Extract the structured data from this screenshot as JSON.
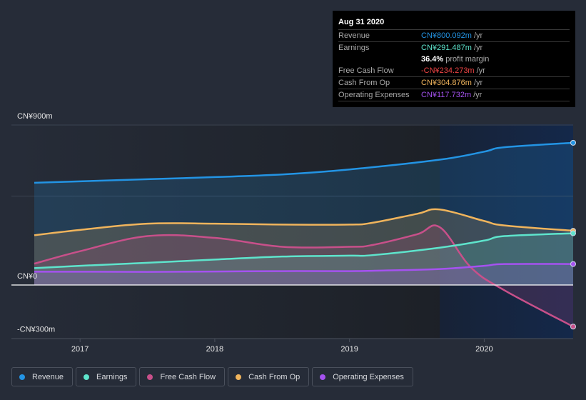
{
  "tooltip": {
    "date": "Aug 31 2020",
    "rows": [
      {
        "label": "Revenue",
        "value": "CN¥800.092m",
        "unit": "/yr",
        "color": "#2394e4"
      },
      {
        "label": "Earnings",
        "value": "CN¥291.487m",
        "unit": "/yr",
        "color": "#5ee4cc"
      },
      {
        "label": "",
        "value": "36.4%",
        "unit": "profit margin",
        "color": "#ffffff"
      },
      {
        "label": "Free Cash Flow",
        "value": "-CN¥234.273m",
        "unit": "/yr",
        "color": "#ee4444"
      },
      {
        "label": "Cash From Op",
        "value": "CN¥304.876m",
        "unit": "/yr",
        "color": "#f0b45c"
      },
      {
        "label": "Operating Expenses",
        "value": "CN¥117.732m",
        "unit": "/yr",
        "color": "#a552f0"
      }
    ]
  },
  "legend": [
    {
      "label": "Revenue",
      "color": "#2394e4"
    },
    {
      "label": "Earnings",
      "color": "#5ee4cc"
    },
    {
      "label": "Free Cash Flow",
      "color": "#c8508a"
    },
    {
      "label": "Cash From Op",
      "color": "#f0b45c"
    },
    {
      "label": "Operating Expenses",
      "color": "#a552f0"
    }
  ],
  "chart_data": {
    "type": "area",
    "title": "",
    "xlabel": "",
    "ylabel": "",
    "ylim": [
      -300,
      900
    ],
    "xlim": [
      2016.66,
      2020.66
    ],
    "y_tick_labels": [
      {
        "value": 900,
        "label": "CN¥900m"
      },
      {
        "value": 0,
        "label": "CN¥0"
      },
      {
        "value": -300,
        "label": "-CN¥300m"
      }
    ],
    "gridlines": [
      900,
      500,
      0
    ],
    "x_ticks": [
      {
        "value": 2017,
        "label": "2017"
      },
      {
        "value": 2018,
        "label": "2018"
      },
      {
        "value": 2019,
        "label": "2019"
      },
      {
        "value": 2020,
        "label": "2020"
      }
    ],
    "forecast_shade_start": 2019.67,
    "series": [
      {
        "name": "Revenue",
        "color": "#2394e4",
        "x": [
          2016.66,
          2017.0,
          2017.5,
          2018.0,
          2018.5,
          2019.0,
          2019.67,
          2020.0,
          2020.15,
          2020.66
        ],
        "values": [
          575,
          583,
          595,
          607,
          622,
          650,
          705,
          750,
          775,
          800
        ]
      },
      {
        "name": "Cash From Op",
        "color": "#f0b45c",
        "x": [
          2016.66,
          2017.0,
          2017.5,
          2018.0,
          2018.5,
          2019.0,
          2019.17,
          2019.5,
          2019.67,
          2020.0,
          2020.15,
          2020.66
        ],
        "values": [
          280,
          310,
          345,
          345,
          340,
          340,
          350,
          400,
          425,
          360,
          335,
          305
        ]
      },
      {
        "name": "Free Cash Flow",
        "color": "#c8508a",
        "x": [
          2016.66,
          2017.0,
          2017.5,
          2018.0,
          2018.5,
          2019.0,
          2019.17,
          2019.5,
          2019.67,
          2019.9,
          2020.15,
          2020.66
        ],
        "values": [
          120,
          190,
          275,
          265,
          215,
          215,
          225,
          285,
          325,
          100,
          -30,
          -234
        ]
      },
      {
        "name": "Earnings",
        "color": "#5ee4cc",
        "x": [
          2016.66,
          2017.0,
          2017.5,
          2018.0,
          2018.5,
          2019.0,
          2019.17,
          2019.67,
          2020.0,
          2020.15,
          2020.66
        ],
        "values": [
          95,
          108,
          125,
          143,
          160,
          165,
          168,
          210,
          250,
          275,
          291
        ]
      },
      {
        "name": "Operating Expenses",
        "color": "#a552f0",
        "x": [
          2016.66,
          2017.0,
          2017.5,
          2018.0,
          2018.5,
          2019.0,
          2019.17,
          2019.67,
          2020.0,
          2020.15,
          2020.66
        ],
        "values": [
          75,
          75,
          74,
          76,
          78,
          78,
          80,
          90,
          108,
          118,
          118
        ]
      }
    ]
  }
}
